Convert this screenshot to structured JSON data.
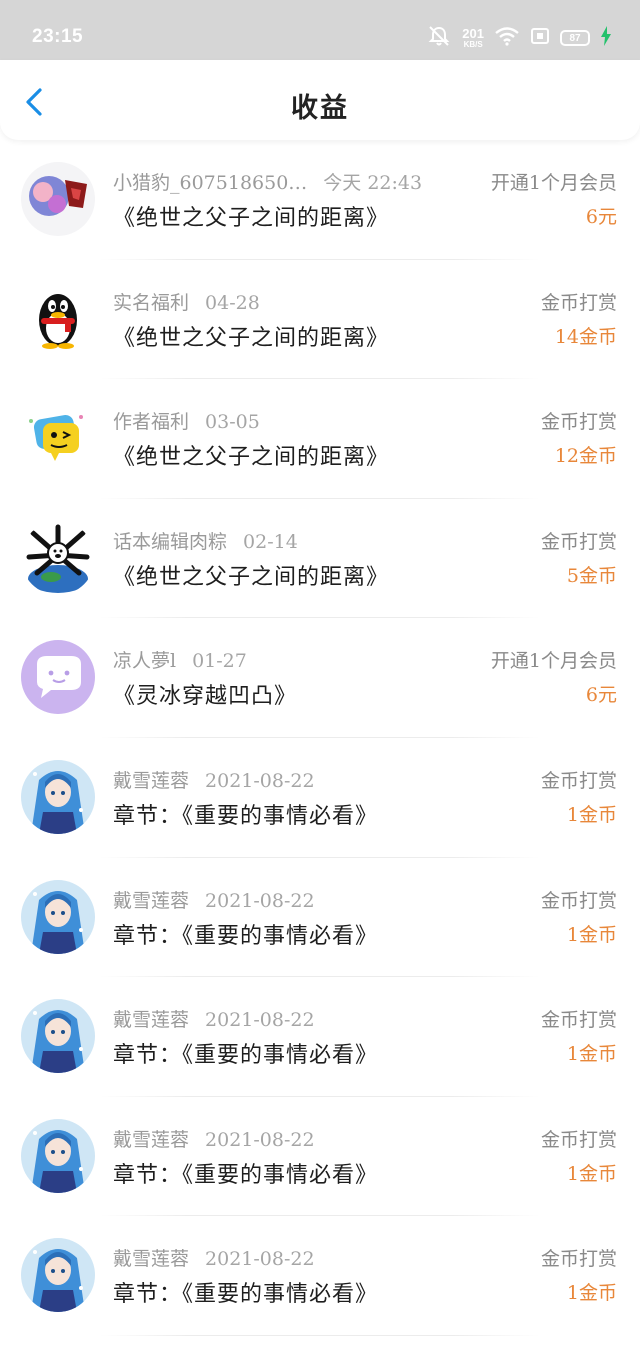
{
  "status_bar": {
    "time": "23:15",
    "net_speed_value": "201",
    "net_speed_unit": "KB/S",
    "battery_level": "87",
    "icons": [
      "mute-bell-icon",
      "wifi-icon",
      "sim-icon",
      "battery-icon",
      "charging-icon"
    ]
  },
  "header": {
    "title": "收益",
    "back_icon": "chevron-left-icon",
    "accent_color": "#1a8ee6"
  },
  "colors": {
    "amount": "#e8873a",
    "meta": "#9a9a9a",
    "title": "#1e1e1e"
  },
  "earnings": [
    {
      "user": "小猎豹_607518650…",
      "time": "今天 22:43",
      "title": "《绝世之父子之间的距离》",
      "type": "开通1个月会员",
      "amount": "6元",
      "avatar": "colorful-art-avatar"
    },
    {
      "user": "实名福利",
      "time": "04-28",
      "title": "《绝世之父子之间的距离》",
      "type": "金币打赏",
      "amount": "14金币",
      "avatar": "penguin-avatar"
    },
    {
      "user": "作者福利",
      "time": "03-05",
      "title": "《绝世之父子之间的距离》",
      "type": "金币打赏",
      "amount": "12金币",
      "avatar": "yellow-emoji-avatar"
    },
    {
      "user": "话本编辑肉粽",
      "time": "02-14",
      "title": "《绝世之父子之间的距离》",
      "type": "金币打赏",
      "amount": "5金币",
      "avatar": "earth-bear-avatar"
    },
    {
      "user": "凉人夢l",
      "time": "01-27",
      "title": "《灵冰穿越凹凸》",
      "type": "开通1个月会员",
      "amount": "6元",
      "avatar": "purple-chat-avatar"
    },
    {
      "user": "戴雪莲蓉",
      "time": "2021-08-22",
      "title": "章节：《重要的事情必看》",
      "type": "金币打赏",
      "amount": "1金币",
      "avatar": "anime-girl-avatar"
    },
    {
      "user": "戴雪莲蓉",
      "time": "2021-08-22",
      "title": "章节：《重要的事情必看》",
      "type": "金币打赏",
      "amount": "1金币",
      "avatar": "anime-girl-avatar"
    },
    {
      "user": "戴雪莲蓉",
      "time": "2021-08-22",
      "title": "章节：《重要的事情必看》",
      "type": "金币打赏",
      "amount": "1金币",
      "avatar": "anime-girl-avatar"
    },
    {
      "user": "戴雪莲蓉",
      "time": "2021-08-22",
      "title": "章节：《重要的事情必看》",
      "type": "金币打赏",
      "amount": "1金币",
      "avatar": "anime-girl-avatar"
    },
    {
      "user": "戴雪莲蓉",
      "time": "2021-08-22",
      "title": "章节：《重要的事情必看》",
      "type": "金币打赏",
      "amount": "1金币",
      "avatar": "anime-girl-avatar"
    }
  ]
}
